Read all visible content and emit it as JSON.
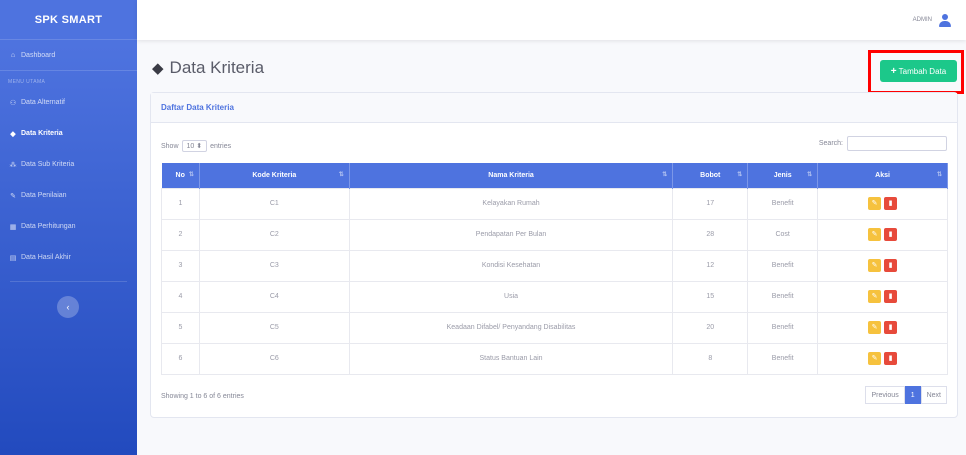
{
  "brand": "SPK SMART",
  "sidebar": {
    "dashboard": {
      "label": "Dashboard",
      "icon": "home-icon"
    },
    "heading": "MENU UTAMA",
    "items": [
      {
        "label": "Data Alternatif",
        "icon": "users-icon",
        "active": false
      },
      {
        "label": "Data Kriteria",
        "icon": "cube-icon",
        "active": true
      },
      {
        "label": "Data Sub Kriteria",
        "icon": "cubes-icon",
        "active": false
      },
      {
        "label": "Data Penilaian",
        "icon": "edit-icon",
        "active": false
      },
      {
        "label": "Data Perhitungan",
        "icon": "calculator-icon",
        "active": false
      },
      {
        "label": "Data Hasil Akhir",
        "icon": "chart-icon",
        "active": false
      }
    ]
  },
  "topbar": {
    "user": "ADMIN"
  },
  "page": {
    "title": "Data Kriteria",
    "add_button": "Tambah Data"
  },
  "card": {
    "title": "Daftar Data Kriteria",
    "show_label": "Show",
    "entries_value": "10",
    "entries_label": "entries",
    "search_label": "Search:",
    "columns": [
      "No",
      "Kode Kriteria",
      "Nama Kriteria",
      "Bobot",
      "Jenis",
      "Aksi"
    ],
    "rows": [
      {
        "no": "1",
        "kode": "C1",
        "nama": "Kelayakan Rumah",
        "bobot": "17",
        "jenis": "Benefit"
      },
      {
        "no": "2",
        "kode": "C2",
        "nama": "Pendapatan Per Bulan",
        "bobot": "28",
        "jenis": "Cost"
      },
      {
        "no": "3",
        "kode": "C3",
        "nama": "Kondisi Kesehatan",
        "bobot": "12",
        "jenis": "Benefit"
      },
      {
        "no": "4",
        "kode": "C4",
        "nama": "Usia",
        "bobot": "15",
        "jenis": "Benefit"
      },
      {
        "no": "5",
        "kode": "C5",
        "nama": "Keadaan Difabel/ Penyandang Disabilitas",
        "bobot": "20",
        "jenis": "Benefit"
      },
      {
        "no": "6",
        "kode": "C6",
        "nama": "Status Bantuan Lain",
        "bobot": "8",
        "jenis": "Benefit"
      }
    ],
    "info": "Showing 1 to 6 of 6 entries",
    "pagination": {
      "previous": "Previous",
      "current": "1",
      "next": "Next"
    }
  },
  "colors": {
    "primary": "#4e73df",
    "success": "#1cc88a",
    "warning": "#f6c23e",
    "danger": "#e74a3b",
    "highlight": "#ff0000"
  }
}
